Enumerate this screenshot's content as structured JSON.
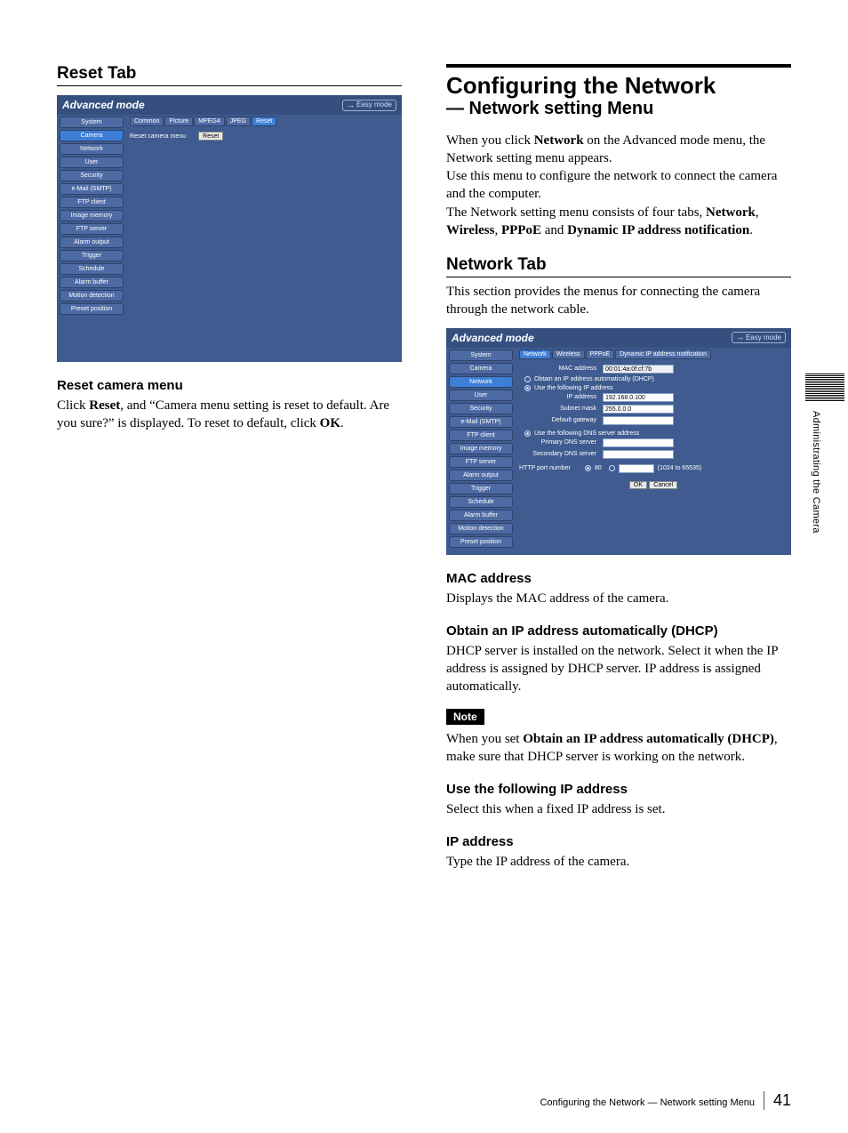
{
  "left": {
    "sec_title": "Reset Tab",
    "sub_h3": "Reset camera menu",
    "sub_p_parts": [
      "Click ",
      "Reset",
      ", and “Camera menu setting is reset to default. Are you sure?” is displayed. To reset to default, click ",
      "OK",
      "."
    ]
  },
  "right": {
    "main_title": "Configuring the Network",
    "subtitle": "— Network setting Menu",
    "intro_parts": [
      "When you click ",
      "Network",
      " on the Advanced mode menu, the Network setting menu appears.",
      "Use this menu to configure the network to connect the camera and the computer.",
      "The Network setting menu consists of four tabs, ",
      "Network",
      ", ",
      "Wireless",
      ", ",
      "PPPoE",
      " and ",
      "Dynamic IP address notification",
      "."
    ],
    "tab_title": "Network Tab",
    "tab_intro": "This section provides the menus for connecting the camera through the network cable.",
    "mac_h": "MAC address",
    "mac_p": "Displays the MAC address of the camera.",
    "dhcp_h": "Obtain an IP address automatically (DHCP)",
    "dhcp_p": "DHCP server is installed on the network. Select it when the IP address is assigned by DHCP server. IP address is assigned automatically.",
    "note_label": "Note",
    "note_p_parts": [
      "When you set ",
      "Obtain an IP address automatically (DHCP)",
      ", make sure that DHCP server is working on the network."
    ],
    "useip_h": "Use the following IP address",
    "useip_p": "Select this when a fixed IP address is set.",
    "ip_h": "IP address",
    "ip_p": "Type the IP address of the camera."
  },
  "shot_common": {
    "mode_label": "Advanced mode",
    "easy_label": "Easy mode",
    "sidebar": [
      "System",
      "Camera",
      "Network",
      "User",
      "Security",
      "e-Mail (SMTP)",
      "FTP client",
      "Image memory",
      "FTP server",
      "Alarm output",
      "Trigger",
      "Schedule",
      "Alarm buffer",
      "Motion detection",
      "Preset position"
    ]
  },
  "shot1": {
    "active_index": 1,
    "tabs": [
      "Common",
      "Picture",
      "MPEG4",
      "JPEG",
      "Reset"
    ],
    "active_tab": 4,
    "row_label": "Reset camera menu",
    "reset_btn": "Reset"
  },
  "shot2": {
    "active_index": 2,
    "tabs": [
      "Network",
      "Wireless",
      "PPPoE",
      "Dynamic IP address notification"
    ],
    "active_tab": 0,
    "mac_label": "MAC address",
    "mac_value": "00:01:4a:0f:cf:7b",
    "radio1": "Obtain an IP address automatically (DHCP)",
    "radio2": "Use the following IP address",
    "ip_label": "IP address",
    "ip_value": "192.168.0.100",
    "subnet_label": "Subnet mask",
    "subnet_value": "255.0.0.0",
    "gateway_label": "Default gateway",
    "radio3": "Use the following DNS server address",
    "dns1_label": "Primary DNS server",
    "dns2_label": "Secondary DNS server",
    "http_label": "HTTP port number",
    "http_opt80": "80",
    "http_range": "(1024 to 65535)",
    "ok": "OK",
    "cancel": "Cancel"
  },
  "side_text": "Administrating the Camera",
  "footer_text": "Configuring the Network — Network setting Menu",
  "page_number": "41"
}
